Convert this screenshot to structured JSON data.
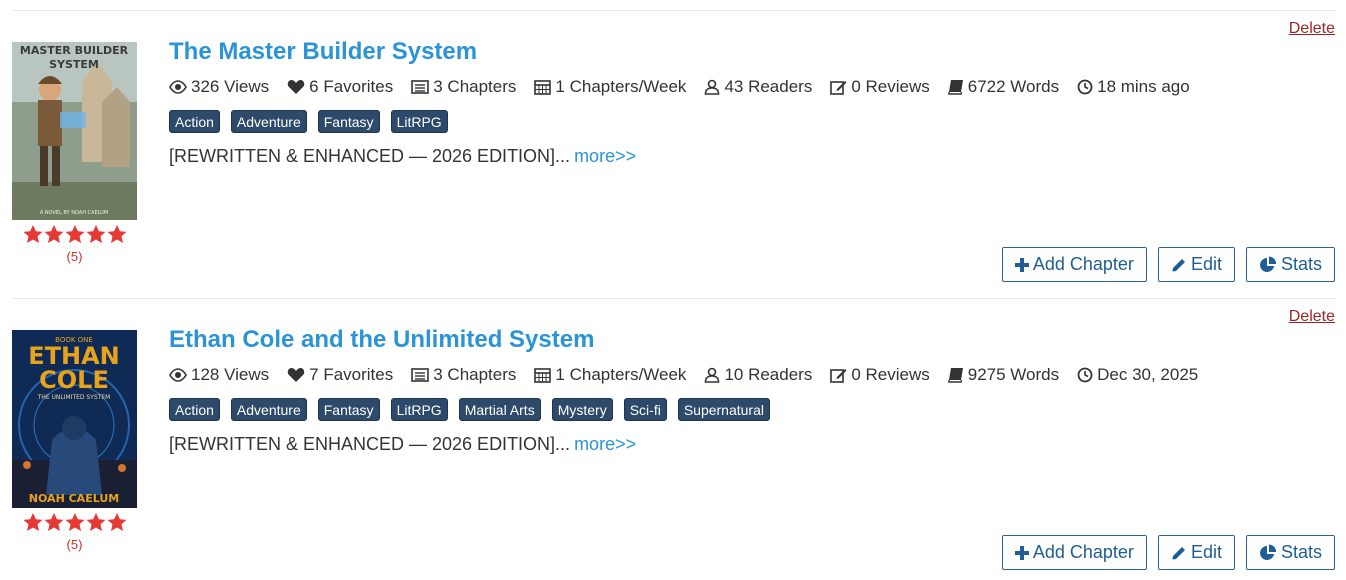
{
  "stories": [
    {
      "title": "The Master Builder System",
      "delete_label": "Delete",
      "cover": {
        "top_text": "MASTER BUILDER",
        "sub_text": "SYSTEM",
        "bottom_text": "A NOVEL BY NOAH CAELUM",
        "bg": "#a7b8b0",
        "accent": "#7a5a3b"
      },
      "rating": {
        "stars": 5,
        "count_label": "(5)"
      },
      "stats": {
        "views": "326 Views",
        "favorites": "6 Favorites",
        "chapters": "3 Chapters",
        "frequency": "1 Chapters/Week",
        "readers": "43 Readers",
        "reviews": "0 Reviews",
        "words": "6722 Words",
        "updated": "18 mins ago"
      },
      "tags": [
        "Action",
        "Adventure",
        "Fantasy",
        "LitRPG"
      ],
      "description": "[REWRITTEN & ENHANCED — 2026 EDITION]...",
      "more_label": "more>>",
      "actions": {
        "add_chapter": "Add Chapter",
        "edit": "Edit",
        "stats": "Stats"
      }
    },
    {
      "title": "Ethan Cole and the Unlimited System",
      "delete_label": "Delete",
      "cover": {
        "top_text": "BOOK ONE",
        "main1": "ETHAN",
        "main2": "COLE",
        "sub_text": "THE UNLIMITED SYSTEM",
        "bottom_text": "NOAH CAELUM",
        "bg": "#0f2a55",
        "accent": "#e8a31c"
      },
      "rating": {
        "stars": 5,
        "count_label": "(5)"
      },
      "stats": {
        "views": "128 Views",
        "favorites": "7 Favorites",
        "chapters": "3 Chapters",
        "frequency": "1 Chapters/Week",
        "readers": "10 Readers",
        "reviews": "0 Reviews",
        "words": "9275 Words",
        "updated": "Dec 30, 2025"
      },
      "tags": [
        "Action",
        "Adventure",
        "Fantasy",
        "LitRPG",
        "Martial Arts",
        "Mystery",
        "Sci-fi",
        "Supernatural"
      ],
      "description": "[REWRITTEN & ENHANCED — 2026 EDITION]...",
      "more_label": "more>>",
      "actions": {
        "add_chapter": "Add Chapter",
        "edit": "Edit",
        "stats": "Stats"
      }
    }
  ],
  "colors": {
    "title": "#2a94d6",
    "tag_bg": "#2d4a6b",
    "star": "#e53935",
    "delete": "#a32424",
    "button": "#1f5e94"
  }
}
